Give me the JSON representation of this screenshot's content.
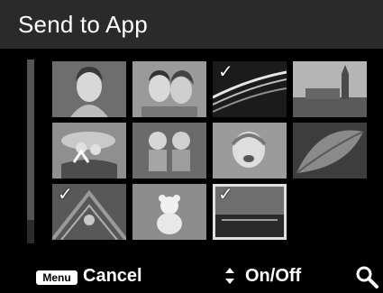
{
  "header": {
    "title": "Send to App"
  },
  "grid": {
    "thumbnails": [
      {
        "subject": "woman-portrait",
        "selected": false
      },
      {
        "subject": "couple-portrait",
        "selected": false
      },
      {
        "subject": "night-road",
        "selected": true
      },
      {
        "subject": "big-ben-london",
        "selected": false
      },
      {
        "subject": "kids-jumping",
        "selected": false
      },
      {
        "subject": "twins-sitting",
        "selected": false
      },
      {
        "subject": "baby-crying",
        "selected": false
      },
      {
        "subject": "leaf-closeup",
        "selected": false
      },
      {
        "subject": "playground",
        "selected": true
      },
      {
        "subject": "teddy-bear",
        "selected": false
      },
      {
        "subject": "beach-pier",
        "selected": true
      }
    ],
    "check_mark": "✓"
  },
  "footer": {
    "menu_badge": "Menu",
    "cancel_label": "Cancel",
    "toggle_label": "On/Off",
    "updown_icon": "up-down-arrows-icon",
    "zoom_icon": "magnifier-icon"
  }
}
